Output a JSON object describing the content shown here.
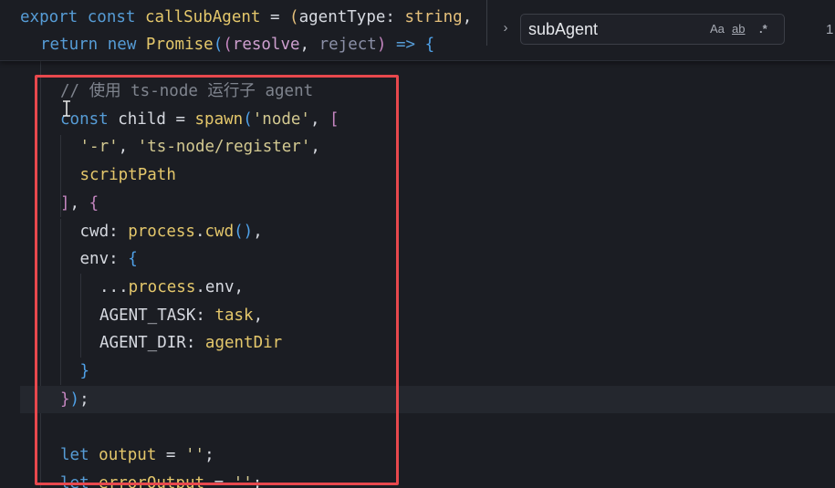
{
  "header_lines": [
    [
      [
        "kw",
        "export"
      ],
      [
        "pl",
        " "
      ],
      [
        "kw",
        "const"
      ],
      [
        "pl",
        " "
      ],
      [
        "fn",
        "callSubAgent"
      ],
      [
        "pl",
        " = "
      ],
      [
        "ty",
        "("
      ],
      [
        "pl",
        "agentType: "
      ],
      [
        "ty",
        "string"
      ],
      [
        "pl",
        ","
      ]
    ],
    [
      [
        "kw",
        "return"
      ],
      [
        "pl",
        " "
      ],
      [
        "kw",
        "new"
      ],
      [
        "pl",
        " "
      ],
      [
        "fn",
        "Promise"
      ],
      [
        "br",
        "("
      ],
      [
        "pu",
        "("
      ],
      [
        "par",
        "resolve"
      ],
      [
        "pl",
        ", "
      ],
      [
        "rej",
        "reject"
      ],
      [
        "pu",
        ")"
      ],
      [
        "pl",
        " "
      ],
      [
        "kw",
        "=>"
      ],
      [
        "pl",
        " "
      ],
      [
        "br",
        "{"
      ]
    ]
  ],
  "code_lines": [
    [
      [
        "cm",
        "// 使用 ts-node 运行子 agent"
      ]
    ],
    [
      [
        "kw",
        "const"
      ],
      [
        "pl",
        " child = "
      ],
      [
        "fn",
        "spawn"
      ],
      [
        "br",
        "("
      ],
      [
        "str",
        "'node'"
      ],
      [
        "pl",
        ", "
      ],
      [
        "pu",
        "["
      ]
    ],
    [
      [
        "str",
        "'-r'"
      ],
      [
        "pl",
        ", "
      ],
      [
        "str",
        "'ts-node/register'"
      ],
      [
        "pl",
        ","
      ]
    ],
    [
      [
        "fn",
        "scriptPath"
      ]
    ],
    [
      [
        "pu",
        "]"
      ],
      [
        "pl",
        ", "
      ],
      [
        "pu",
        "{"
      ]
    ],
    [
      [
        "pl",
        "cwd: "
      ],
      [
        "fn",
        "process"
      ],
      [
        "pl",
        "."
      ],
      [
        "fn",
        "cwd"
      ],
      [
        "br",
        "()"
      ],
      [
        "pl",
        ","
      ]
    ],
    [
      [
        "pl",
        "env: "
      ],
      [
        "br",
        "{"
      ]
    ],
    [
      [
        "pl",
        "..."
      ],
      [
        "fn",
        "process"
      ],
      [
        "pl",
        ".env,"
      ]
    ],
    [
      [
        "pl",
        "AGENT_TASK: "
      ],
      [
        "fn",
        "task"
      ],
      [
        "pl",
        ","
      ]
    ],
    [
      [
        "pl",
        "AGENT_DIR: "
      ],
      [
        "fn",
        "agentDir"
      ]
    ],
    [
      [
        "br",
        "}"
      ]
    ],
    [
      [
        "pu",
        "}"
      ],
      [
        "br",
        ")"
      ],
      [
        "pl",
        ";"
      ]
    ],
    [],
    [
      [
        "kw",
        "let"
      ],
      [
        "pl",
        " "
      ],
      [
        "fn",
        "output"
      ],
      [
        "pl",
        " = "
      ],
      [
        "str",
        "''"
      ],
      [
        "pl",
        ";"
      ]
    ],
    [
      [
        "kw",
        "let"
      ],
      [
        "pl",
        " "
      ],
      [
        "fn",
        "errorOutput"
      ],
      [
        "pl",
        " = "
      ],
      [
        "str",
        "''"
      ],
      [
        "pl",
        ";"
      ]
    ]
  ],
  "find": {
    "value": "subAgent",
    "options": [
      "Aa",
      "ab",
      ".*"
    ],
    "result": "1"
  },
  "icons": {
    "toggle": "chevron-right-icon",
    "cursor": "text-cursor-icon"
  },
  "colors": {
    "highlight": "#e8484d",
    "keyword": "#569cd6",
    "function": "#e4c76b",
    "string": "#d3c991",
    "comment": "#7f848e"
  }
}
